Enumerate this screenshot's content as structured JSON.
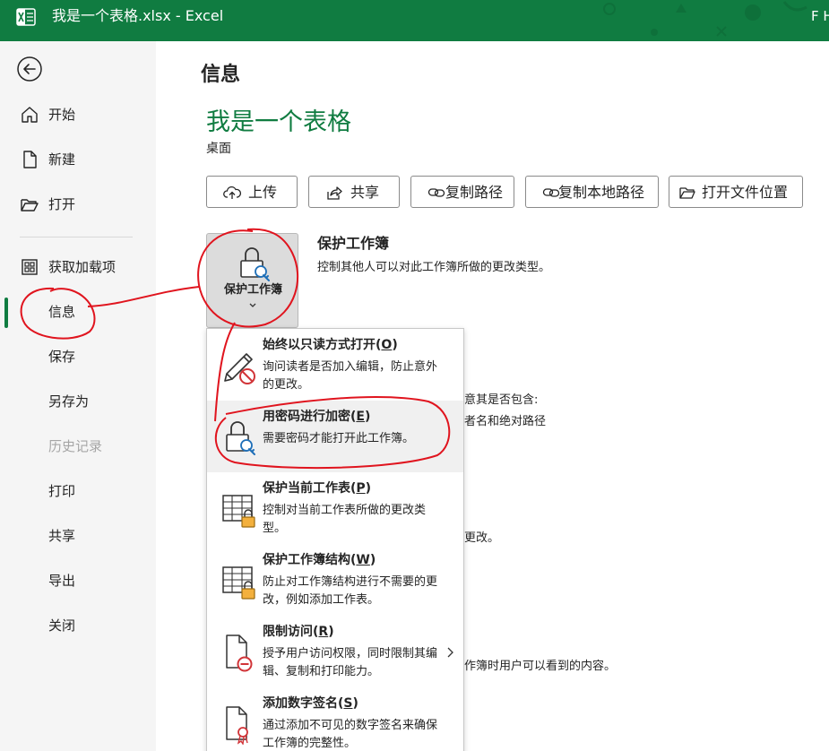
{
  "window": {
    "title": "我是一个表格.xlsx  -  Excel",
    "user": "F H"
  },
  "sidebar": {
    "items": [
      {
        "label": "开始",
        "icon": "home-icon"
      },
      {
        "label": "新建",
        "icon": "new-file-icon"
      },
      {
        "label": "打开",
        "icon": "folder-open-icon"
      },
      {
        "label": "获取加载项",
        "icon": "grid-icon"
      },
      {
        "label": "信息",
        "active": true
      },
      {
        "label": "保存"
      },
      {
        "label": "另存为"
      },
      {
        "label": "历史记录",
        "disabled": true
      },
      {
        "label": "打印"
      },
      {
        "label": "共享"
      },
      {
        "label": "导出"
      },
      {
        "label": "关闭"
      }
    ]
  },
  "main": {
    "page_title": "信息",
    "doc_name": "我是一个表格",
    "doc_location": "桌面",
    "buttons": [
      {
        "label": "上传",
        "icon": "upload-cloud-icon"
      },
      {
        "label": "共享",
        "icon": "share-icon"
      },
      {
        "label": "复制路径",
        "icon": "link-icon"
      },
      {
        "label": "复制本地路径",
        "icon": "link-icon"
      },
      {
        "label": "打开文件位置",
        "icon": "folder-icon"
      }
    ],
    "protect_tile": {
      "label": "保护工作簿"
    },
    "protect_section": {
      "title": "保护工作簿",
      "desc": "控制其他人可以对此工作簿所做的更改类型。"
    },
    "background_fragments": [
      "意其是否包含:",
      "者名和绝对路径",
      "更改。",
      "作簿时用户可以看到的内容。"
    ]
  },
  "menu": {
    "items": [
      {
        "title": "始终以只读方式打开",
        "key": "O",
        "desc": "询问读者是否加入编辑，防止意外的更改。",
        "icon": "pencil-no-icon"
      },
      {
        "title": "用密码进行加密",
        "key": "E",
        "desc": "需要密码才能打开此工作簿。",
        "icon": "lock-key-icon",
        "highlight": true
      },
      {
        "title": "保护当前工作表",
        "key": "P",
        "desc": "控制对当前工作表所做的更改类型。",
        "icon": "sheet-lock-icon"
      },
      {
        "title": "保护工作簿结构",
        "key": "W",
        "desc": "防止对工作簿结构进行不需要的更改，例如添加工作表。",
        "icon": "sheet-lock-icon"
      },
      {
        "title": "限制访问",
        "key": "R",
        "desc": "授予用户访问权限，同时限制其编辑、复制和打印能力。",
        "icon": "doc-restrict-icon",
        "submenu": true
      },
      {
        "title": "添加数字签名",
        "key": "S",
        "desc": "通过添加不可见的数字签名来确保工作簿的完整性。",
        "icon": "doc-ribbon-icon"
      }
    ]
  },
  "colors": {
    "excel_green": "#107c41",
    "annotation_red": "#e0141e"
  }
}
